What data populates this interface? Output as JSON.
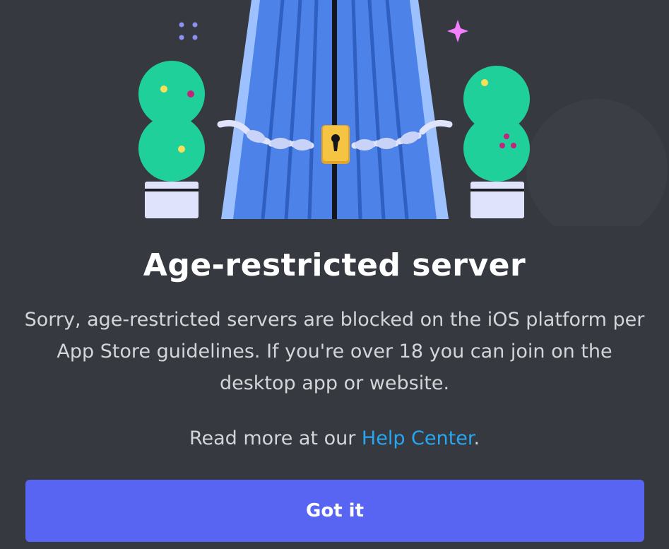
{
  "modal": {
    "title": "Age-restricted server",
    "body": "Sorry, age-restricted servers are blocked on the iOS platform per App Store guidelines. If you're over 18 you can join on the desktop app or website.",
    "help_prefix": "Read more at our ",
    "help_link": "Help Center",
    "help_suffix": ".",
    "button_label": "Got it"
  },
  "illustration": {
    "icons": [
      "sparkle-dots-icon",
      "sparkle-star-icon",
      "potted-bush-icon",
      "locked-gate-icon",
      "padlock-icon",
      "chain-icon"
    ]
  },
  "colors": {
    "background": "#36393f",
    "title": "#ffffff",
    "body": "#d4d5d8",
    "link": "#27a7f2",
    "button": "#5865f2",
    "gate": "#4d82e8",
    "bush": "#1fd09a",
    "lock": "#f6c443"
  }
}
